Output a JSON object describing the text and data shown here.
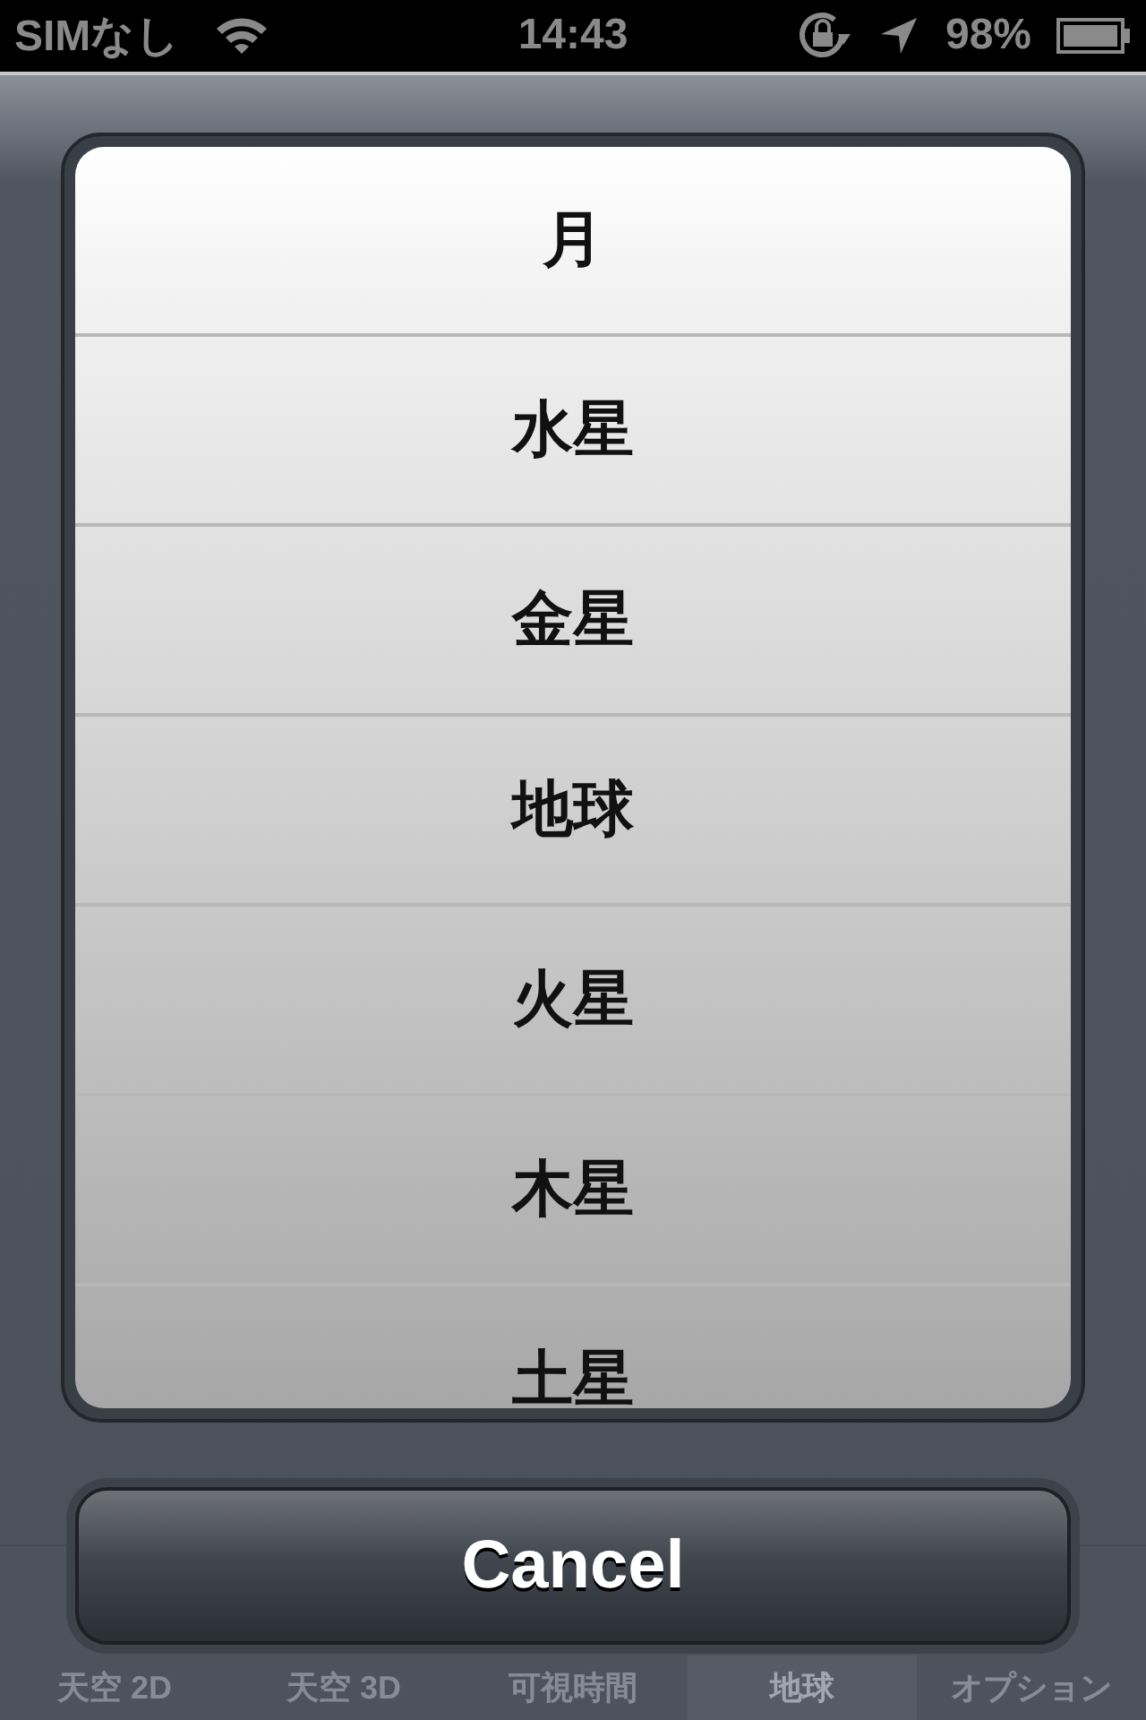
{
  "status_bar": {
    "carrier": "SIMなし",
    "time": "14:43",
    "battery": "98%"
  },
  "picker": {
    "items": [
      {
        "label": "月"
      },
      {
        "label": "水星"
      },
      {
        "label": "金星"
      },
      {
        "label": "地球"
      },
      {
        "label": "火星"
      },
      {
        "label": "木星"
      },
      {
        "label": "土星"
      }
    ]
  },
  "cancel_button": {
    "label": "Cancel"
  },
  "tab_bar": {
    "tabs": [
      {
        "label": "天空 2D",
        "selected": false
      },
      {
        "label": "天空 3D",
        "selected": false
      },
      {
        "label": "可視時間",
        "selected": false
      },
      {
        "label": "地球",
        "selected": true
      },
      {
        "label": "オプション",
        "selected": false
      }
    ]
  }
}
